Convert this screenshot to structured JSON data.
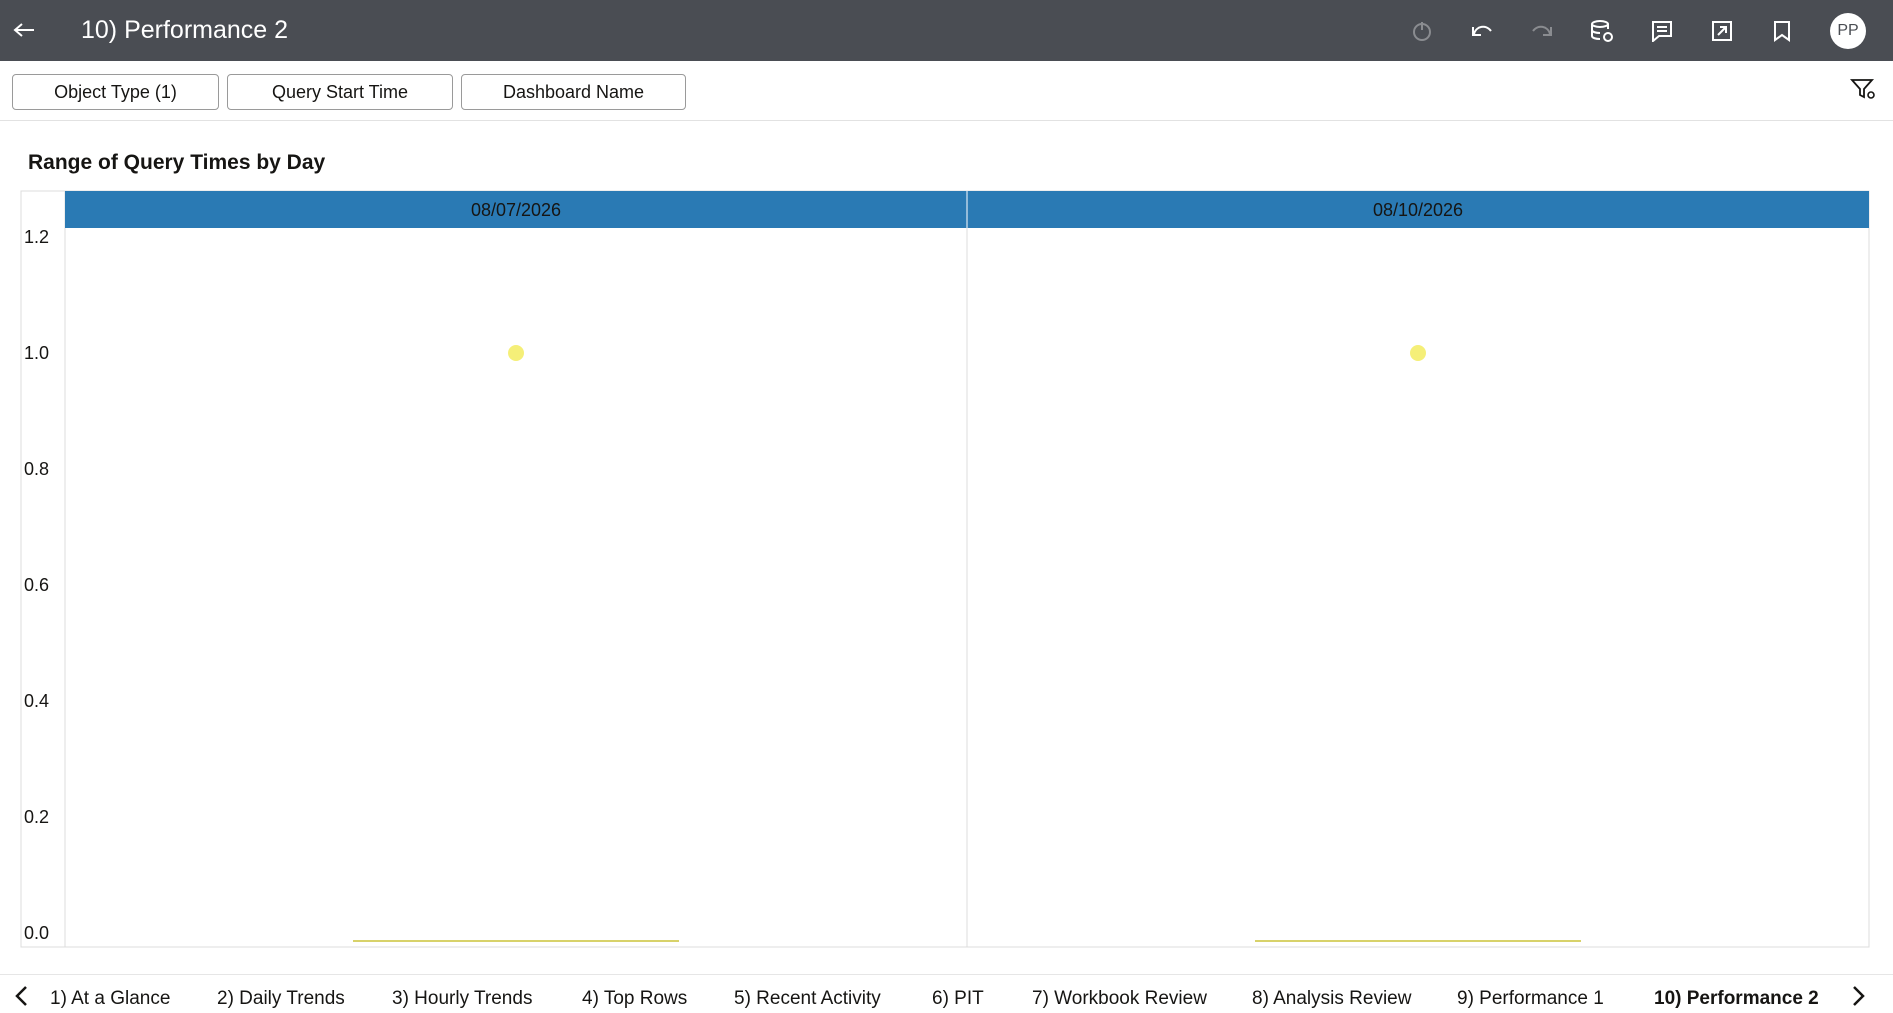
{
  "header": {
    "title": "10) Performance 2",
    "avatar_initials": "PP",
    "icons": [
      "back-arrow-icon",
      "refresh-icon",
      "undo-icon",
      "redo-icon",
      "data-refresh-icon",
      "comment-icon",
      "present-icon",
      "bookmark-icon"
    ]
  },
  "filters": {
    "chips": [
      "Object Type (1)",
      "Query Start Time",
      "Dashboard Name"
    ],
    "settings_icon": "filter-settings-icon"
  },
  "colors": {
    "header_bg": "#4a4d53",
    "panel_header_bg": "#2a7ab4",
    "point": "#f5ef78"
  },
  "chart_data": {
    "type": "scatter",
    "title": "Range of Query Times by Day",
    "panels": [
      "08/07/2026",
      "08/10/2026"
    ],
    "ylim": [
      0,
      1.2
    ],
    "yticks": [
      "1.2",
      "1.0",
      "0.8",
      "0.6",
      "0.4",
      "0.2",
      "0.0"
    ],
    "series": [
      {
        "values": [
          1.0,
          1.0
        ]
      }
    ],
    "baseline_values": [
      0,
      0
    ]
  },
  "tabs": {
    "items": [
      "1) At a Glance",
      "2) Daily Trends",
      "3) Hourly Trends",
      "4) Top Rows",
      "5) Recent Activity",
      "6) PIT",
      "7) Workbook Review",
      "8) Analysis Review",
      "9) Performance 1",
      "10) Performance 2"
    ],
    "active_index": 9
  }
}
